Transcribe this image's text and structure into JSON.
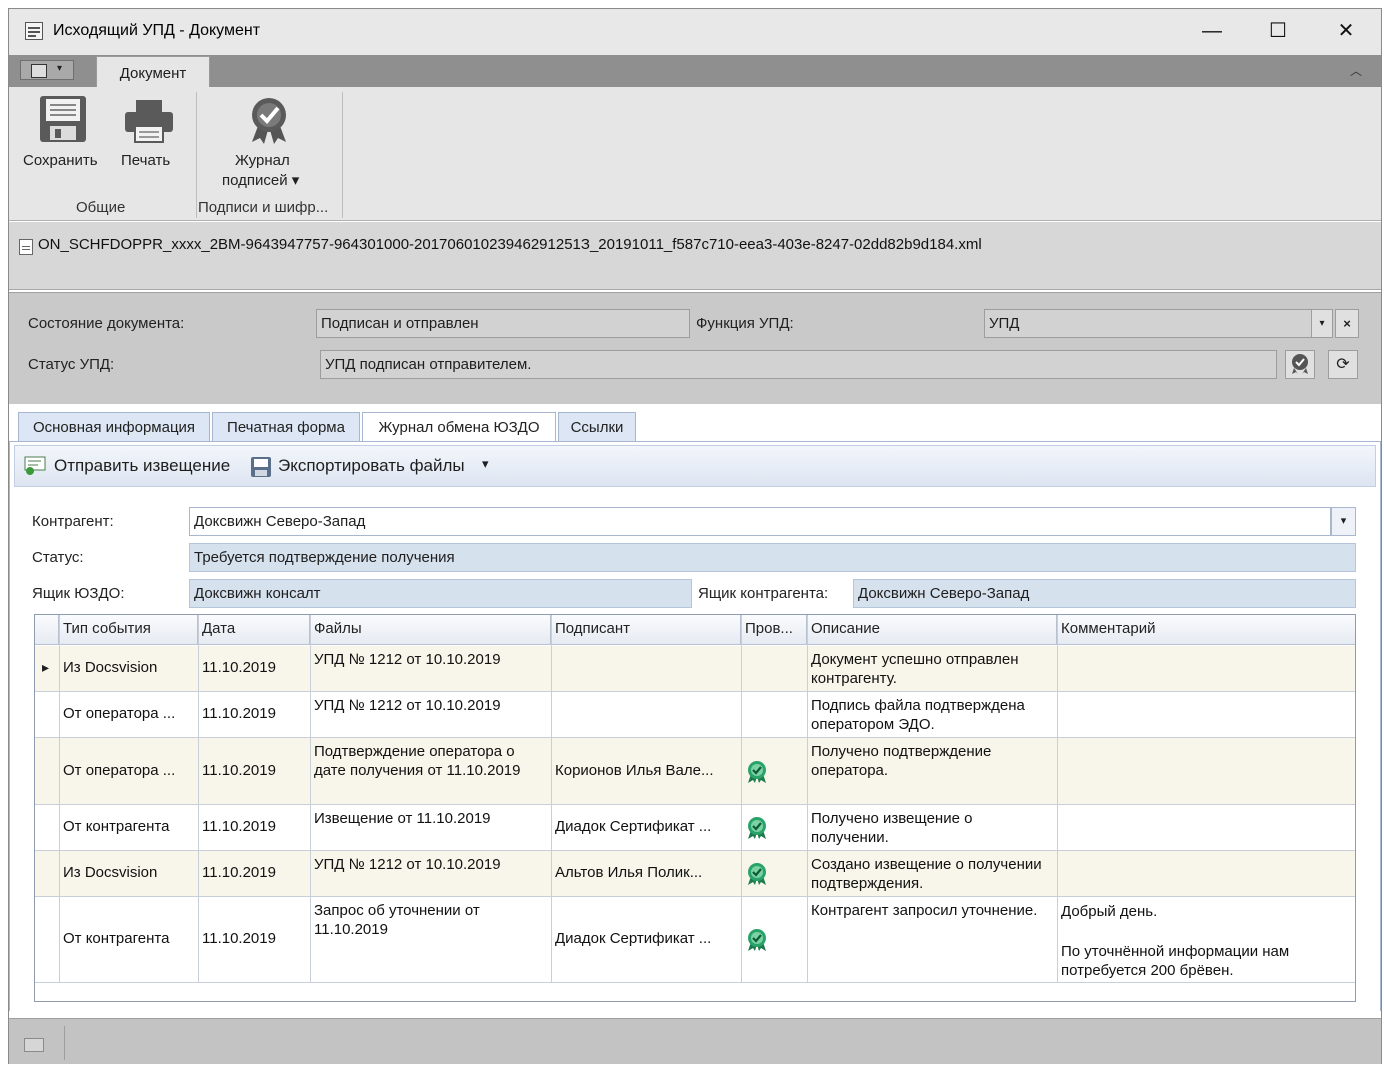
{
  "window": {
    "title": "Исходящий УПД - Документ",
    "minimize": "—",
    "maximize": "☐",
    "close": "✕"
  },
  "ribbon": {
    "tab": "Документ",
    "buttons": {
      "save": "Сохранить",
      "print": "Печать",
      "journal_line1": "Журнал",
      "journal_line2": "подписей ▾"
    },
    "groups": {
      "common": "Общие",
      "signatures": "Подписи и шифр..."
    }
  },
  "file": {
    "name": "ON_SCHFDOPPR_xxxx_2BM-9643947757-964301000-20170601023946291251З_20191011_f587c710-eea3-403e-8247-02dd82b9d184.xml"
  },
  "status_panel": {
    "doc_state_label": "Состояние документа:",
    "doc_state_value": "Подписан и отправлен",
    "function_label": "Функция УПД:",
    "function_value": "УПД",
    "upd_status_label": "Статус УПД:",
    "upd_status_value": "УПД подписан отправителем."
  },
  "tabs": [
    {
      "label": "Основная информация"
    },
    {
      "label": "Печатная форма"
    },
    {
      "label": "Журнал обмена ЮЗДО"
    },
    {
      "label": "Ссылки"
    }
  ],
  "toolbar": {
    "send_notice": "Отправить извещение",
    "export_files": "Экспортировать файлы",
    "export_arrow": "▾"
  },
  "form": {
    "counterparty_label": "Контрагент:",
    "counterparty_value": "Доксвижн Северо-Запад",
    "status_label": "Статус:",
    "status_value": "Требуется подтверждение получения",
    "box_label": "Ящик ЮЗДО:",
    "box_value": "Доксвижн консалт",
    "cp_box_label": "Ящик контрагента:",
    "cp_box_value": "Доксвижн Северо-Запад"
  },
  "grid": {
    "columns": [
      "Тип события",
      "Дата",
      "Файлы",
      "Подписант",
      "Пров...",
      "Описание",
      "Комментарий"
    ],
    "rows": [
      {
        "type": "Из Docsvision",
        "date": "11.10.2019",
        "files": "УПД № 1212 от 10.10.2019",
        "signer": "",
        "verified": false,
        "description": "Документ успешно отправлен контрагенту.",
        "comment": "",
        "comment2": ""
      },
      {
        "type": "От оператора ...",
        "date": "11.10.2019",
        "files": "УПД № 1212 от 10.10.2019",
        "signer": "",
        "verified": false,
        "description": "Подпись файла подтверждена оператором ЭДО.",
        "comment": "",
        "comment2": ""
      },
      {
        "type": "От оператора ...",
        "date": "11.10.2019",
        "files": "Подтверждение оператора о дате получения от 11.10.2019",
        "signer": "Корионов Илья Вале...",
        "verified": true,
        "description": "Получено подтверждение оператора.",
        "comment": "",
        "comment2": ""
      },
      {
        "type": "От контрагента",
        "date": "11.10.2019",
        "files": "Извещение от 11.10.2019",
        "signer": "Диадок Сертификат ...",
        "verified": true,
        "description": "Получено извещение о получении.",
        "comment": "",
        "comment2": ""
      },
      {
        "type": "Из Docsvision",
        "date": "11.10.2019",
        "files": "УПД № 1212 от 10.10.2019",
        "signer": "Альтов Илья Полик...",
        "verified": true,
        "description": "Создано извещение о получении подтверждения.",
        "comment": "",
        "comment2": ""
      },
      {
        "type": "От контрагента",
        "date": "11.10.2019",
        "files": "Запрос об уточнении от 11.10.2019",
        "signer": "Диадок Сертификат ...",
        "verified": true,
        "description": "Контрагент запросил уточнение.",
        "comment": "Добрый день.",
        "comment2": "По уточнённой информации нам потребуется 200 брёвен."
      }
    ]
  }
}
